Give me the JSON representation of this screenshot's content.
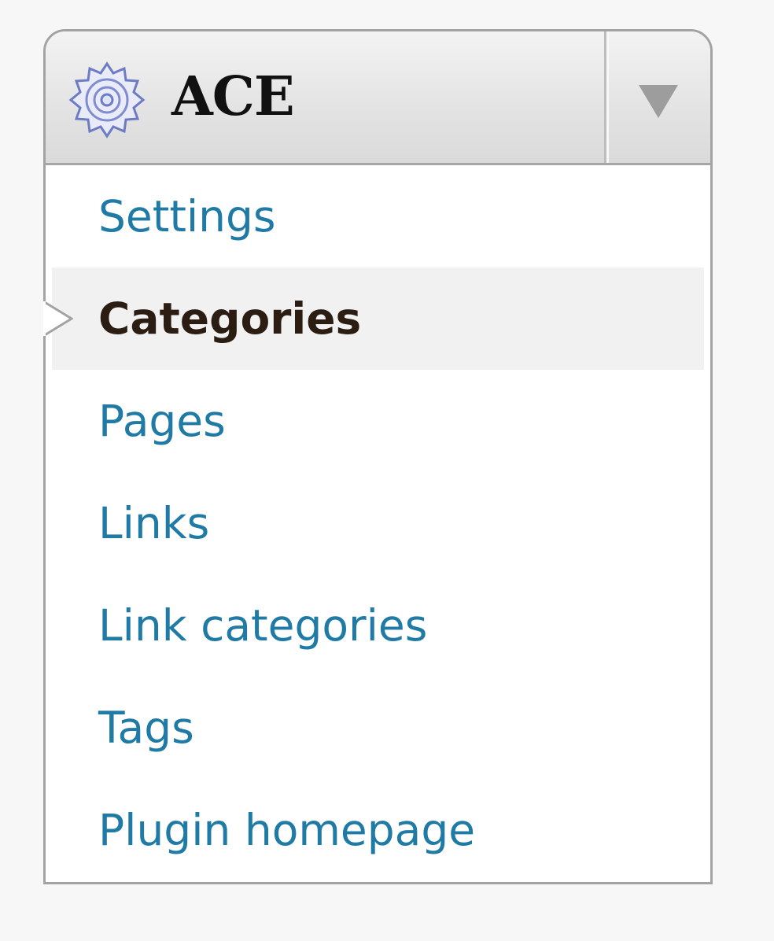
{
  "header": {
    "title": "ACE",
    "icon": "gear-icon",
    "toggle_icon": "triangle-down-icon"
  },
  "menu": {
    "items": [
      {
        "label": "Settings",
        "current": false
      },
      {
        "label": "Categories",
        "current": true
      },
      {
        "label": "Pages",
        "current": false
      },
      {
        "label": "Links",
        "current": false
      },
      {
        "label": "Link categories",
        "current": false
      },
      {
        "label": "Tags",
        "current": false
      },
      {
        "label": "Plugin homepage",
        "current": false
      }
    ]
  },
  "colors": {
    "link": "#1f7ba6",
    "current_text": "#2b1d12",
    "current_bg": "#f1f1f1",
    "border": "#a3a3a3",
    "icon": "#6d7bc4"
  }
}
